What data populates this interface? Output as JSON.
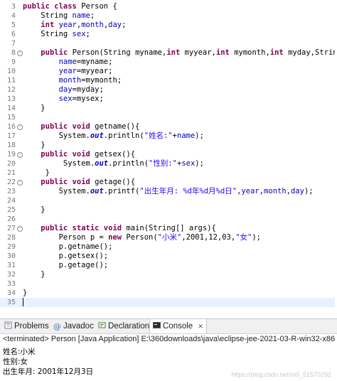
{
  "editor": {
    "lines": [
      {
        "n": "3",
        "segs": [
          [
            "kw",
            "public class "
          ],
          [
            "",
            "Person {"
          ]
        ]
      },
      {
        "n": "4",
        "segs": [
          [
            "",
            "    String "
          ],
          [
            "fld",
            "name"
          ],
          [
            "",
            ";"
          ]
        ]
      },
      {
        "n": "5",
        "segs": [
          [
            "",
            "    "
          ],
          [
            "kw",
            "int "
          ],
          [
            "fld",
            "year"
          ],
          [
            "",
            ","
          ],
          [
            "fld",
            "month"
          ],
          [
            "",
            ","
          ],
          [
            "fld",
            "day"
          ],
          [
            "",
            ";"
          ]
        ]
      },
      {
        "n": "6",
        "segs": [
          [
            "",
            "    String "
          ],
          [
            "fld",
            "sex"
          ],
          [
            "",
            ";"
          ]
        ]
      },
      {
        "n": "7",
        "segs": []
      },
      {
        "n": "8",
        "fold": true,
        "segs": [
          [
            "",
            "    "
          ],
          [
            "kw",
            "public "
          ],
          [
            "",
            "Person(String myname,"
          ],
          [
            "kw",
            "int "
          ],
          [
            "",
            "myyear,"
          ],
          [
            "kw",
            "int "
          ],
          [
            "",
            "mymonth,"
          ],
          [
            "kw",
            "int "
          ],
          [
            "",
            "myday,String mysex){"
          ]
        ]
      },
      {
        "n": "9",
        "segs": [
          [
            "",
            "        "
          ],
          [
            "fld",
            "name"
          ],
          [
            "",
            "=myname;"
          ]
        ]
      },
      {
        "n": "10",
        "segs": [
          [
            "",
            "        "
          ],
          [
            "fld",
            "year"
          ],
          [
            "",
            "=myyear;"
          ]
        ]
      },
      {
        "n": "11",
        "segs": [
          [
            "",
            "        "
          ],
          [
            "fld",
            "month"
          ],
          [
            "",
            "=mymonth;"
          ]
        ]
      },
      {
        "n": "12",
        "segs": [
          [
            "",
            "        "
          ],
          [
            "fld",
            "day"
          ],
          [
            "",
            "=myday;"
          ]
        ]
      },
      {
        "n": "13",
        "segs": [
          [
            "",
            "        "
          ],
          [
            "fld",
            "sex"
          ],
          [
            "",
            "=mysex;"
          ]
        ]
      },
      {
        "n": "14",
        "segs": [
          [
            "",
            "    }"
          ]
        ]
      },
      {
        "n": "15",
        "segs": []
      },
      {
        "n": "16",
        "fold": true,
        "segs": [
          [
            "",
            "    "
          ],
          [
            "kw",
            "public void "
          ],
          [
            "",
            "getname(){"
          ]
        ]
      },
      {
        "n": "17",
        "segs": [
          [
            "",
            "        System."
          ],
          [
            "st",
            "out"
          ],
          [
            "",
            ".println("
          ],
          [
            "str",
            "\"姓名:\""
          ],
          [
            "",
            "+"
          ],
          [
            "fld",
            "name"
          ],
          [
            "",
            ");"
          ]
        ]
      },
      {
        "n": "18",
        "segs": [
          [
            "",
            "    }"
          ]
        ]
      },
      {
        "n": "19",
        "fold": true,
        "segs": [
          [
            "",
            "    "
          ],
          [
            "kw",
            "public void "
          ],
          [
            "",
            "getsex(){"
          ]
        ]
      },
      {
        "n": "20",
        "segs": [
          [
            "",
            "         System."
          ],
          [
            "st",
            "out"
          ],
          [
            "",
            ".println("
          ],
          [
            "str",
            "\"性别:\""
          ],
          [
            "",
            "+"
          ],
          [
            "fld",
            "sex"
          ],
          [
            "",
            ");"
          ]
        ]
      },
      {
        "n": "21",
        "segs": [
          [
            "",
            "     }"
          ]
        ]
      },
      {
        "n": "22",
        "fold": true,
        "segs": [
          [
            "",
            "    "
          ],
          [
            "kw",
            "public void "
          ],
          [
            "",
            "getage(){"
          ]
        ]
      },
      {
        "n": "23",
        "segs": [
          [
            "",
            "        System."
          ],
          [
            "st",
            "out"
          ],
          [
            "",
            ".printf("
          ],
          [
            "str",
            "\"出生年月: %d年%d月%d日\""
          ],
          [
            "",
            ","
          ],
          [
            "fld",
            "year"
          ],
          [
            "",
            ","
          ],
          [
            "fld",
            "month"
          ],
          [
            "",
            ","
          ],
          [
            "fld",
            "day"
          ],
          [
            "",
            ");"
          ]
        ]
      },
      {
        "n": "24",
        "segs": []
      },
      {
        "n": "25",
        "segs": [
          [
            "",
            "    }"
          ]
        ]
      },
      {
        "n": "26",
        "segs": []
      },
      {
        "n": "27",
        "fold": true,
        "segs": [
          [
            "",
            "    "
          ],
          [
            "kw",
            "public static void "
          ],
          [
            "",
            "main(String[] args){"
          ]
        ]
      },
      {
        "n": "28",
        "segs": [
          [
            "",
            "        Person p = "
          ],
          [
            "kw",
            "new "
          ],
          [
            "",
            "Person("
          ],
          [
            "str",
            "\"小米\""
          ],
          [
            "",
            ",2001,12,03,"
          ],
          [
            "str",
            "\"女\""
          ],
          [
            "",
            ");"
          ]
        ]
      },
      {
        "n": "29",
        "segs": [
          [
            "",
            "        p.getname();"
          ]
        ]
      },
      {
        "n": "30",
        "segs": [
          [
            "",
            "        p.getsex();"
          ]
        ]
      },
      {
        "n": "31",
        "segs": [
          [
            "",
            "        p.getage();"
          ]
        ]
      },
      {
        "n": "32",
        "segs": [
          [
            "",
            "    }"
          ]
        ]
      },
      {
        "n": "33",
        "segs": []
      },
      {
        "n": "34",
        "segs": [
          [
            "",
            "}"
          ]
        ]
      },
      {
        "n": "35",
        "segs": [],
        "current": true
      }
    ]
  },
  "panel": {
    "tabs": [
      {
        "label": "Problems",
        "icon": "problems-icon"
      },
      {
        "label": "Javadoc",
        "icon": "javadoc-icon"
      },
      {
        "label": "Declaration",
        "icon": "declaration-icon"
      },
      {
        "label": "Console",
        "icon": "console-icon"
      }
    ],
    "close_glyph": "✕",
    "terminated": "<terminated> Person [Java Application] E:\\360downloads\\java\\eclipse-jee-2021-03-R-win32-x86",
    "output": [
      "姓名:小米",
      "性别:女",
      "出生年月: 2001年12月3日"
    ],
    "watermark": "https://blog.csdn.net/m0_51570292"
  }
}
